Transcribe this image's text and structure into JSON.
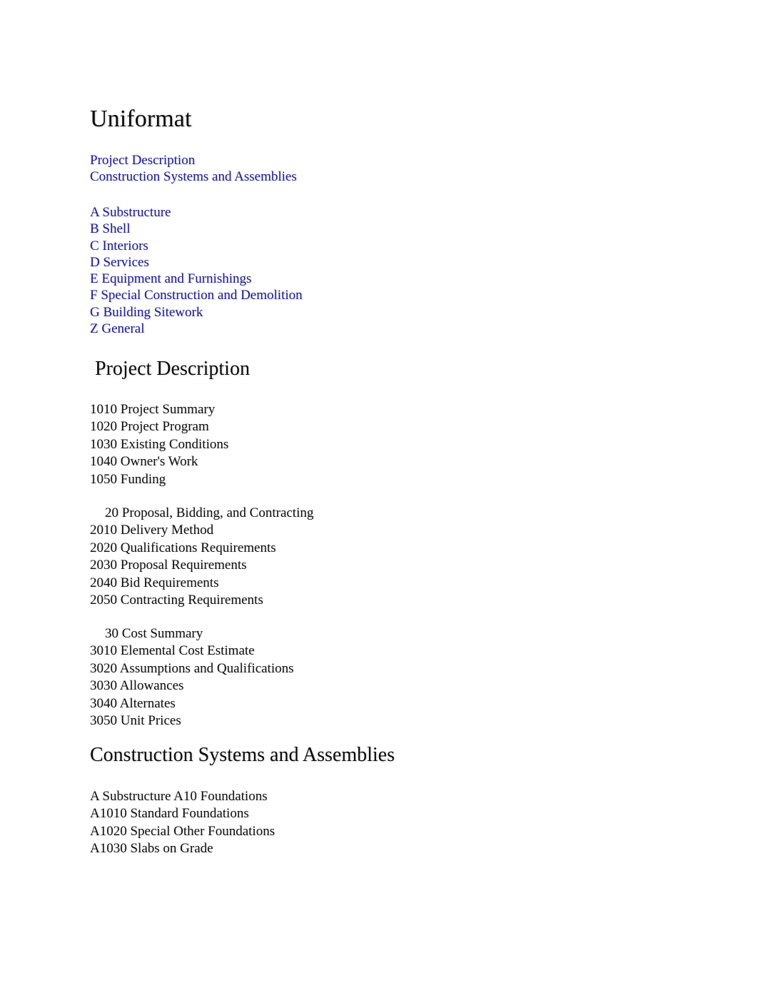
{
  "document": {
    "title": "Uniformat",
    "link_color": "#1a1a8c",
    "text_color": "#0d0d0d",
    "background_color": "#ffffff"
  },
  "nav": {
    "top_links": [
      {
        "label": "Project Description"
      },
      {
        "label": "Construction Systems and Assemblies"
      }
    ],
    "category_links": [
      {
        "label": "A Substructure"
      },
      {
        "label": "B Shell"
      },
      {
        "label": "C Interiors"
      },
      {
        "label": "D Services"
      },
      {
        "label": "E Equipment and Furnishings"
      },
      {
        "label": "F Special Construction and Demolition"
      },
      {
        "label": "G Building Sitework"
      },
      {
        "label": "Z General"
      }
    ]
  },
  "sections": {
    "project_description": {
      "heading": "Project Description",
      "group_10": [
        {
          "label": "1010 Project Summary"
        },
        {
          "label": "1020 Project Program"
        },
        {
          "label": "1030 Existing Conditions"
        },
        {
          "label": "1040 Owner's Work"
        },
        {
          "label": "1050 Funding"
        }
      ],
      "group_20": [
        {
          "label": "20 Proposal, Bidding, and Contracting"
        },
        {
          "label": "2010 Delivery Method"
        },
        {
          "label": "2020 Qualifications Requirements"
        },
        {
          "label": "2030 Proposal Requirements"
        },
        {
          "label": "2040 Bid Requirements"
        },
        {
          "label": "2050 Contracting Requirements"
        }
      ],
      "group_30": [
        {
          "label": "30 Cost Summary"
        },
        {
          "label": "3010 Elemental Cost Estimate"
        },
        {
          "label": "3020 Assumptions and Qualifications"
        },
        {
          "label": "3030 Allowances"
        },
        {
          "label": "3040 Alternates"
        },
        {
          "label": "3050 Unit Prices"
        }
      ]
    },
    "construction_systems": {
      "heading": "Construction Systems and Assemblies",
      "group_a10": [
        {
          "label": "A Substructure A10 Foundations"
        },
        {
          "label": "A1010 Standard Foundations"
        },
        {
          "label": "A1020 Special Other Foundations"
        },
        {
          "label": "A1030 Slabs on Grade"
        }
      ]
    }
  }
}
